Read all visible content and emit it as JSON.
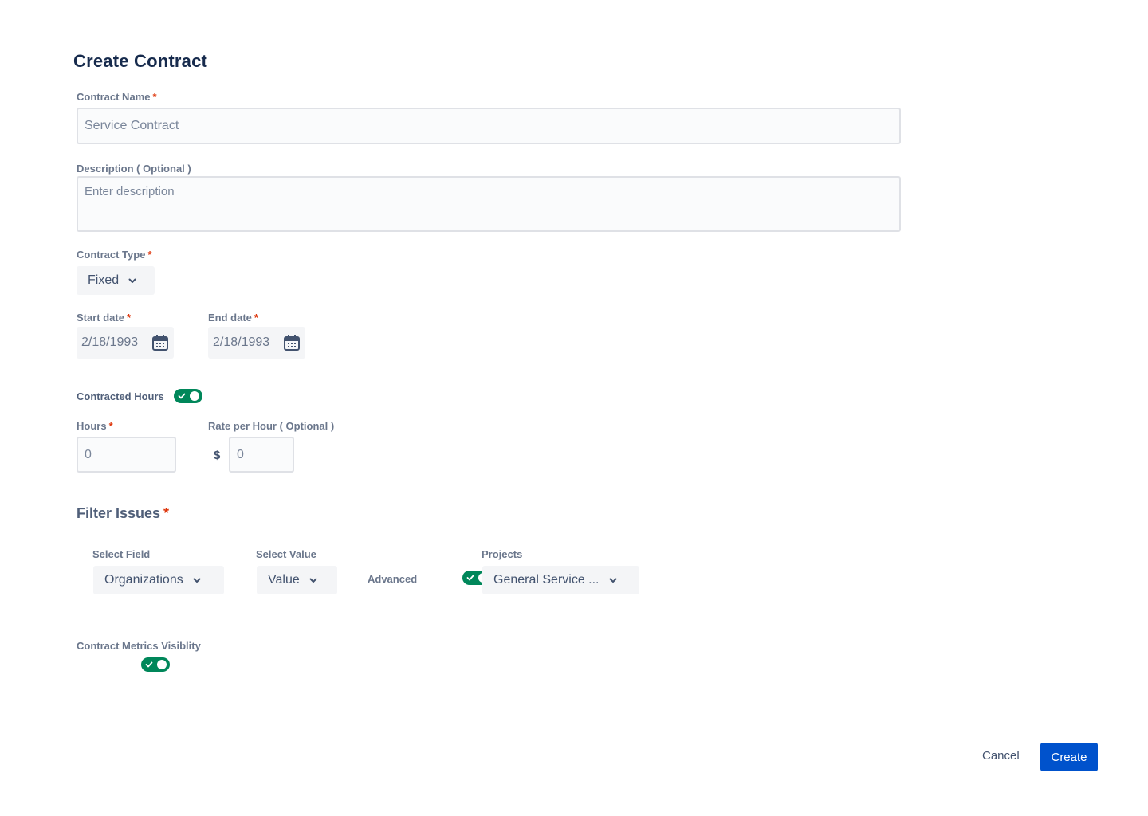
{
  "page": {
    "title": "Create Contract"
  },
  "contract_name": {
    "label": "Contract Name",
    "required_mark": "*",
    "placeholder": "Service Contract"
  },
  "description": {
    "label": "Description ( Optional )",
    "placeholder": "Enter description"
  },
  "contract_type": {
    "label": "Contract Type",
    "required_mark": "*",
    "value": "Fixed"
  },
  "start_date": {
    "label": "Start date",
    "required_mark": "*",
    "value": "2/18/1993",
    "icon": "calendar-icon"
  },
  "end_date": {
    "label": "End date",
    "required_mark": "*",
    "value": "2/18/1993",
    "icon": "calendar-icon"
  },
  "contracted_hours": {
    "label": "Contracted Hours",
    "toggle_on": true
  },
  "hours": {
    "label": "Hours",
    "required_mark": "*",
    "placeholder": "0"
  },
  "rate": {
    "label": "Rate per Hour ( Optional )",
    "currency": "$",
    "placeholder": "0"
  },
  "filter_issues": {
    "title": "Filter Issues",
    "required_mark": "*",
    "select_field": {
      "label": "Select Field",
      "value": "Organizations"
    },
    "select_value": {
      "label": "Select Value",
      "value": "Value"
    },
    "advanced": {
      "label": "Advanced",
      "toggle_on": true
    },
    "projects": {
      "label": "Projects",
      "value": "General Service ..."
    }
  },
  "metrics_visibility": {
    "label": "Contract Metrics Visiblity",
    "toggle_on": true
  },
  "actions": {
    "cancel_label": "Cancel",
    "create_label": "Create"
  },
  "colors": {
    "accent": "#0052cc",
    "toggle_on": "#00875a",
    "required": "#de350b"
  }
}
